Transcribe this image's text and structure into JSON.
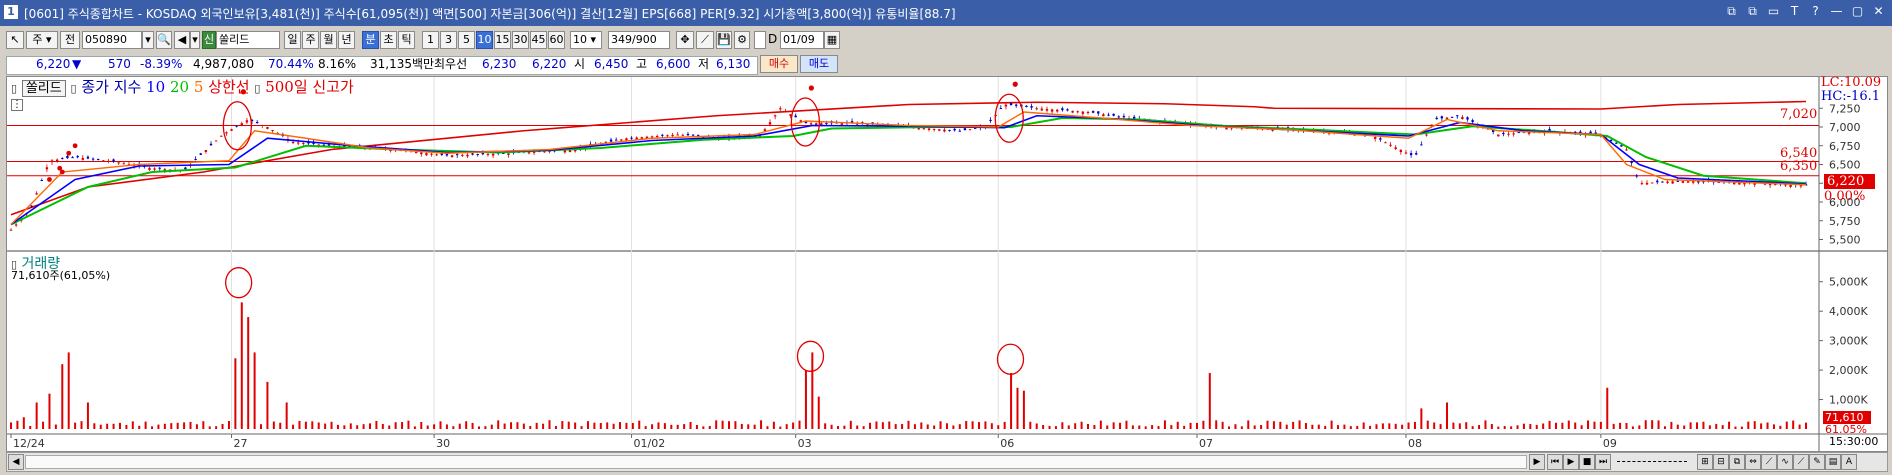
{
  "title": {
    "icon": "1",
    "text": "[0601] 주식종합차트 - KOSDAQ 외국인보유[3,481(천)] 주식수[61,095(천)] 액면[500] 자본금[306(억)] 결산[12월] EPS[668] PER[9.32] 시가총액[3,800(억)] 유통비율[88.7]",
    "window_buttons": [
      "⧉",
      "⧉",
      "▭",
      "T",
      "?",
      "—",
      "▢",
      "✕"
    ]
  },
  "toolbar": {
    "market": "주",
    "all": "전",
    "code": "050890",
    "strategy_badge": "신",
    "stock_name": "쏠리드",
    "periods": [
      "일",
      "주",
      "월",
      "년",
      "분",
      "초",
      "틱"
    ],
    "active_period": "분",
    "intervals": [
      "1",
      "3",
      "5",
      "10",
      "15",
      "30",
      "45",
      "60"
    ],
    "active_interval": "10",
    "count_select": "10",
    "count_display": "349",
    "count_total": "/900",
    "date": "01/09",
    "checkbox_label": "D"
  },
  "quote": {
    "price": "6,220",
    "arrow": "▼",
    "change": "570",
    "change_rate": "-8.39%",
    "volume": "4,987,080",
    "vol_ratio": "70.44%",
    "turnover": "8.16%",
    "amount": "31,135백만",
    "best_bid_label": "최우선",
    "bid": "6,230",
    "ask": "6,220",
    "open_label": "시",
    "open": "6,450",
    "high_label": "고",
    "high": "6,600",
    "low_label": "저",
    "low": "6,130",
    "buy_button": "매수",
    "sell_button": "매도"
  },
  "legend": {
    "name": "쏠리드",
    "series_label": "종가 지수",
    "ma10": "10",
    "ma20": "20",
    "ma5": "5",
    "upper_limit": "상한선",
    "new_high": "500일 신고가"
  },
  "price_axis": {
    "ticks": [
      "7,250",
      "7,000",
      "6,750",
      "6,500",
      "6,250",
      "6,000",
      "5,750",
      "5,500"
    ],
    "lc_label": "LC:10.09",
    "hc_label": "HC:-16.1",
    "current_price": "6,220",
    "current_change": "0.00%",
    "hlines": [
      "7,020",
      "6,540",
      "6,350"
    ]
  },
  "volume_panel": {
    "title": "거래량",
    "info": "71,610주(61,05%)",
    "ticks": [
      "5,000K",
      "4,000K",
      "3,000K",
      "2,000K",
      "1,000K"
    ],
    "current": "71,610",
    "current_rate": "61.05%"
  },
  "time_axis": {
    "labels": [
      "12/24",
      "27",
      "30",
      "01/02",
      "03",
      "06",
      "07",
      "08",
      "09"
    ],
    "clock": "15:30:00"
  },
  "colors": {
    "up": "#e00000",
    "down": "#0000cc",
    "ma5": "#ff6a00",
    "ma10": "#0000ff",
    "ma20": "#00c000",
    "new_high_line": "#e00000",
    "title_bar": "#3a5ea8"
  },
  "chart_data": {
    "type": "candlestick",
    "x": [
      "12/24",
      "27",
      "30",
      "01/02",
      "03",
      "06",
      "07",
      "08",
      "09"
    ],
    "ylim": [
      5400,
      7400
    ],
    "hlines": [
      7020,
      6540,
      6350
    ],
    "close_points": [
      [
        0,
        5630
      ],
      [
        15,
        5900
      ],
      [
        30,
        6550
      ],
      [
        50,
        6600
      ],
      [
        80,
        6540
      ],
      [
        110,
        6450
      ],
      [
        135,
        6420
      ],
      [
        165,
        6900
      ],
      [
        185,
        7100
      ],
      [
        200,
        7000
      ],
      [
        220,
        6800
      ],
      [
        250,
        6750
      ],
      [
        300,
        6700
      ],
      [
        340,
        6620
      ],
      [
        390,
        6650
      ],
      [
        440,
        6700
      ],
      [
        480,
        6850
      ],
      [
        520,
        6900
      ],
      [
        560,
        6850
      ],
      [
        585,
        6900
      ],
      [
        600,
        7250
      ],
      [
        620,
        7050
      ],
      [
        660,
        7050
      ],
      [
        700,
        7000
      ],
      [
        740,
        6950
      ],
      [
        760,
        7000
      ],
      [
        775,
        7300
      ],
      [
        800,
        7250
      ],
      [
        840,
        7200
      ],
      [
        880,
        7100
      ],
      [
        920,
        7050
      ],
      [
        940,
        7000
      ],
      [
        980,
        6980
      ],
      [
        1020,
        6950
      ],
      [
        1060,
        6900
      ],
      [
        1095,
        6600
      ],
      [
        1110,
        7100
      ],
      [
        1130,
        7150
      ],
      [
        1160,
        6900
      ],
      [
        1200,
        6950
      ],
      [
        1240,
        6900
      ],
      [
        1260,
        6700
      ],
      [
        1270,
        6250
      ],
      [
        1300,
        6280
      ],
      [
        1350,
        6260
      ],
      [
        1400,
        6220
      ]
    ],
    "ma5": [
      [
        0,
        5700
      ],
      [
        40,
        6400
      ],
      [
        100,
        6500
      ],
      [
        170,
        6550
      ],
      [
        190,
        6950
      ],
      [
        230,
        6850
      ],
      [
        280,
        6720
      ],
      [
        340,
        6650
      ],
      [
        420,
        6700
      ],
      [
        500,
        6850
      ],
      [
        580,
        6900
      ],
      [
        620,
        7080
      ],
      [
        700,
        7020
      ],
      [
        770,
        7000
      ],
      [
        790,
        7200
      ],
      [
        850,
        7120
      ],
      [
        920,
        7020
      ],
      [
        1000,
        6960
      ],
      [
        1090,
        6850
      ],
      [
        1120,
        7100
      ],
      [
        1160,
        6950
      ],
      [
        1240,
        6900
      ],
      [
        1260,
        6500
      ],
      [
        1290,
        6300
      ],
      [
        1400,
        6230
      ]
    ],
    "ma10": [
      [
        0,
        5700
      ],
      [
        50,
        6300
      ],
      [
        100,
        6480
      ],
      [
        170,
        6500
      ],
      [
        200,
        6850
      ],
      [
        260,
        6760
      ],
      [
        340,
        6660
      ],
      [
        420,
        6690
      ],
      [
        500,
        6820
      ],
      [
        580,
        6880
      ],
      [
        625,
        7020
      ],
      [
        700,
        7010
      ],
      [
        775,
        6990
      ],
      [
        800,
        7150
      ],
      [
        860,
        7110
      ],
      [
        930,
        7020
      ],
      [
        1000,
        6960
      ],
      [
        1090,
        6880
      ],
      [
        1130,
        7060
      ],
      [
        1180,
        6950
      ],
      [
        1240,
        6900
      ],
      [
        1270,
        6500
      ],
      [
        1300,
        6320
      ],
      [
        1400,
        6240
      ]
    ],
    "ma20": [
      [
        0,
        5700
      ],
      [
        60,
        6200
      ],
      [
        110,
        6400
      ],
      [
        175,
        6460
      ],
      [
        230,
        6750
      ],
      [
        300,
        6700
      ],
      [
        380,
        6660
      ],
      [
        460,
        6720
      ],
      [
        540,
        6830
      ],
      [
        610,
        6880
      ],
      [
        640,
        6980
      ],
      [
        720,
        7000
      ],
      [
        780,
        7000
      ],
      [
        820,
        7120
      ],
      [
        880,
        7100
      ],
      [
        950,
        7010
      ],
      [
        1020,
        6960
      ],
      [
        1095,
        6900
      ],
      [
        1140,
        7010
      ],
      [
        1200,
        6940
      ],
      [
        1245,
        6880
      ],
      [
        1275,
        6600
      ],
      [
        1320,
        6350
      ],
      [
        1400,
        6250
      ]
    ],
    "high_line": [
      [
        0,
        5830
      ],
      [
        60,
        6200
      ],
      [
        150,
        6400
      ],
      [
        250,
        6700
      ],
      [
        400,
        6950
      ],
      [
        550,
        7150
      ],
      [
        700,
        7300
      ],
      [
        800,
        7330
      ],
      [
        900,
        7310
      ],
      [
        970,
        7270
      ],
      [
        985,
        7250
      ],
      [
        1240,
        7240
      ],
      [
        1300,
        7300
      ],
      [
        1400,
        7340
      ]
    ],
    "volume_spikes": [
      [
        8,
        400
      ],
      [
        20,
        900
      ],
      [
        30,
        1200
      ],
      [
        38,
        2200
      ],
      [
        45,
        2600
      ],
      [
        60,
        900
      ],
      [
        175,
        2400
      ],
      [
        180,
        4300
      ],
      [
        185,
        3800
      ],
      [
        192,
        2600
      ],
      [
        200,
        1600
      ],
      [
        215,
        900
      ],
      [
        620,
        2000
      ],
      [
        625,
        2600
      ],
      [
        630,
        1100
      ],
      [
        778,
        1900
      ],
      [
        785,
        1400
      ],
      [
        790,
        1300
      ],
      [
        933,
        1900
      ],
      [
        1100,
        700
      ],
      [
        1120,
        900
      ],
      [
        1245,
        1400
      ],
      [
        1400,
        150
      ]
    ],
    "event_markers": [
      [
        175,
        7150
      ],
      [
        618,
        7200
      ],
      [
        777,
        7250
      ]
    ],
    "volume_markers": [
      [
        176,
        4900
      ],
      [
        622,
        2400
      ],
      [
        778,
        2300
      ]
    ]
  }
}
